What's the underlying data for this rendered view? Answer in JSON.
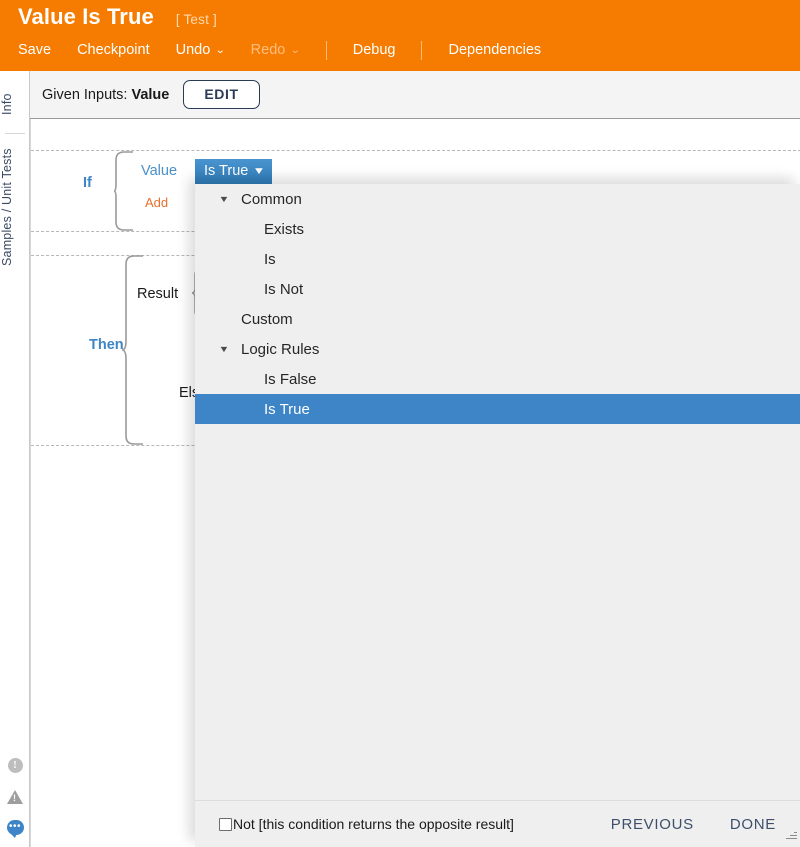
{
  "header": {
    "title": "Value Is True",
    "subtitle": "[ Test ]",
    "menu": [
      {
        "label": "Save",
        "disabled": false,
        "caret": false,
        "sep_after": false
      },
      {
        "label": "Checkpoint",
        "disabled": false,
        "caret": false,
        "sep_after": false
      },
      {
        "label": "Undo",
        "disabled": false,
        "caret": true,
        "sep_after": false
      },
      {
        "label": "Redo",
        "disabled": true,
        "caret": true,
        "sep_after": true
      },
      {
        "label": "Debug",
        "disabled": false,
        "caret": false,
        "sep_after": true
      },
      {
        "label": "Dependencies",
        "disabled": false,
        "caret": false,
        "sep_after": false
      }
    ],
    "caret_glyph": "⌄",
    "brand_color": "#f57c00"
  },
  "rail": {
    "tabs": [
      {
        "label": "Info"
      },
      {
        "label": "Samples / Unit Tests"
      }
    ],
    "status_icons": [
      {
        "name": "info-icon",
        "glyph": "!"
      },
      {
        "name": "warning-icon",
        "glyph": "!"
      },
      {
        "name": "comment-icon",
        "glyph": "•••"
      }
    ]
  },
  "given_inputs": {
    "prefix": "Given Inputs: ",
    "value": "Value",
    "edit_label": "EDIT"
  },
  "rule": {
    "if_label": "If",
    "then_label": "Then",
    "result_label": "Result",
    "else_label": "Else",
    "condition_field": "Value",
    "add_label": "Add",
    "chip_label": "Is True",
    "chip_caret": "▼",
    "chip_color": "#2f7cb8"
  },
  "panel": {
    "tree": [
      {
        "label": "Common",
        "kind": "group",
        "expanded": true,
        "selected": false
      },
      {
        "label": "Exists",
        "kind": "leaf",
        "expanded": false,
        "selected": false
      },
      {
        "label": "Is",
        "kind": "leaf",
        "expanded": false,
        "selected": false
      },
      {
        "label": "Is Not",
        "kind": "leaf",
        "expanded": false,
        "selected": false
      },
      {
        "label": "Custom",
        "kind": "flat",
        "expanded": false,
        "selected": false
      },
      {
        "label": "Logic Rules",
        "kind": "group",
        "expanded": true,
        "selected": false
      },
      {
        "label": "Is False",
        "kind": "leaf",
        "expanded": false,
        "selected": false
      },
      {
        "label": "Is True",
        "kind": "leaf",
        "expanded": false,
        "selected": true
      }
    ],
    "twisty_glyph": "▼",
    "selected_color": "#3d85c6",
    "footer": {
      "not_label": "Not [this condition returns the opposite result]",
      "not_checked": false,
      "previous_label": "PREVIOUS",
      "done_label": "DONE"
    }
  }
}
